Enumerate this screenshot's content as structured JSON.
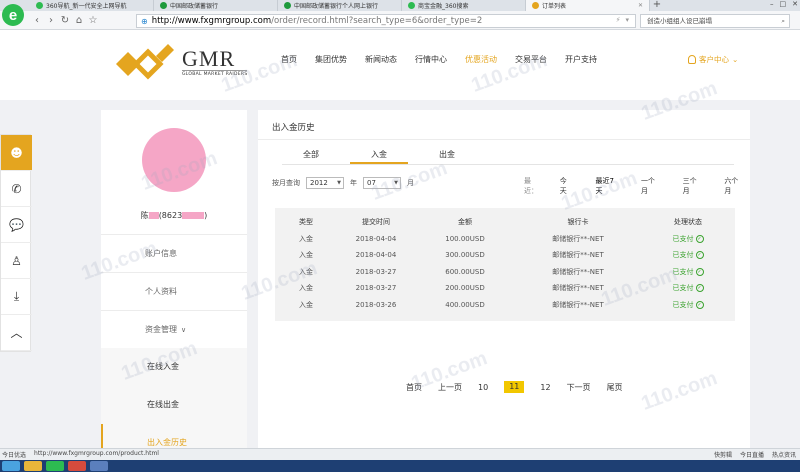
{
  "browser": {
    "tabs": [
      {
        "label": "360导航_新一代安全上网导航",
        "color": "#2dbb51"
      },
      {
        "label": "中国邮政储蓄银行",
        "color": "#1e9a3c"
      },
      {
        "label": "中国邮政储蓄银行个人网上银行",
        "color": "#1e9a3c"
      },
      {
        "label": "商宝金融_360搜索",
        "color": "#2dbb51"
      },
      {
        "label": "订单列表",
        "color": "#e4a51f"
      }
    ],
    "url_host": "http://www.fxgmrgroup.com",
    "url_path": "/order/record.html?search_type=6&order_type=2",
    "side_search": "创造小组组人设已崩塌",
    "status_url": "http://www.fxgmrgroup.com/product.html",
    "status_left_label": "今日优选",
    "status_right": [
      "快剪辑",
      "今日直播",
      "热点资讯"
    ]
  },
  "site": {
    "logo_text": "GMR",
    "logo_sub": "GLOBAL MARKET RAIDERS",
    "nav": [
      "首页",
      "集团优势",
      "新闻动态",
      "行情中心",
      "优惠活动",
      "交易平台",
      "开户支持"
    ],
    "user_center": "客户中心"
  },
  "profile": {
    "name_prefix": "陈",
    "name_mid": "(8623",
    "name_suffix": ")"
  },
  "menu": {
    "account_info": "账户信息",
    "personal": "个人资料",
    "funds": "资金管理",
    "deposit_online": "在线入金",
    "withdraw_online": "在线出金",
    "history": "出入金历史"
  },
  "panel": {
    "title": "出入金历史",
    "tabs": [
      "全部",
      "入金",
      "出金"
    ],
    "filter_label": "按月查询",
    "year": "2012",
    "year_unit": "年",
    "month": "07",
    "month_unit": "月",
    "quick_label": "最近：",
    "quick": [
      "今天",
      "最近7天",
      "一个月",
      "三个月",
      "六个月"
    ]
  },
  "table": {
    "headers": [
      "类型",
      "提交时间",
      "金额",
      "银行卡",
      "处理状态"
    ],
    "rows": [
      [
        "入金",
        "2018-04-04",
        "100.00USD",
        "邮储银行**-NET",
        "已支付"
      ],
      [
        "入金",
        "2018-04-04",
        "300.00USD",
        "邮储银行**-NET",
        "已支付"
      ],
      [
        "入金",
        "2018-03-27",
        "600.00USD",
        "邮储银行**-NET",
        "已支付"
      ],
      [
        "入金",
        "2018-03-27",
        "200.00USD",
        "邮储银行**-NET",
        "已支付"
      ],
      [
        "入金",
        "2018-03-26",
        "400.00USD",
        "邮储银行**-NET",
        "已支付"
      ]
    ]
  },
  "pager": {
    "first": "首页",
    "prev": "上一页",
    "pages": [
      "10",
      "11",
      "12"
    ],
    "current": "11",
    "next": "下一页",
    "last": "尾页"
  },
  "watermark": "110.com",
  "colors": {
    "accent": "#e4a51f",
    "paid": "#3ba32f",
    "page_current": "#f2c700"
  }
}
